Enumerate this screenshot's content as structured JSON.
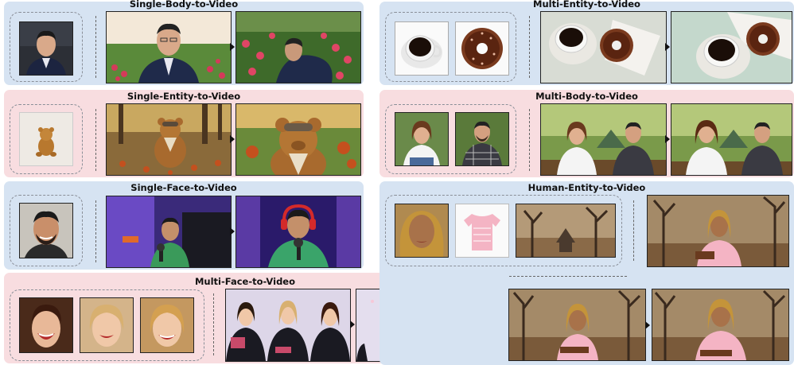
{
  "panels": {
    "single_body": {
      "title": "Single-Body-to-Video"
    },
    "single_entity": {
      "title": "Single-Entity-to-Video"
    },
    "single_face": {
      "title": "Single-Face-to-Video"
    },
    "multi_face": {
      "title": "Multi-Face-to-Video"
    },
    "multi_entity": {
      "title": "Multi-Entity-to-Video"
    },
    "multi_body": {
      "title": "Multi-Body-to-Video"
    },
    "human_entity": {
      "title": "Human-Entity-to-Video"
    }
  },
  "colors": {
    "blue_panel": "#d6e3f2",
    "pink_panel": "#f8dde0",
    "dashed_border": "#8a8f98"
  }
}
